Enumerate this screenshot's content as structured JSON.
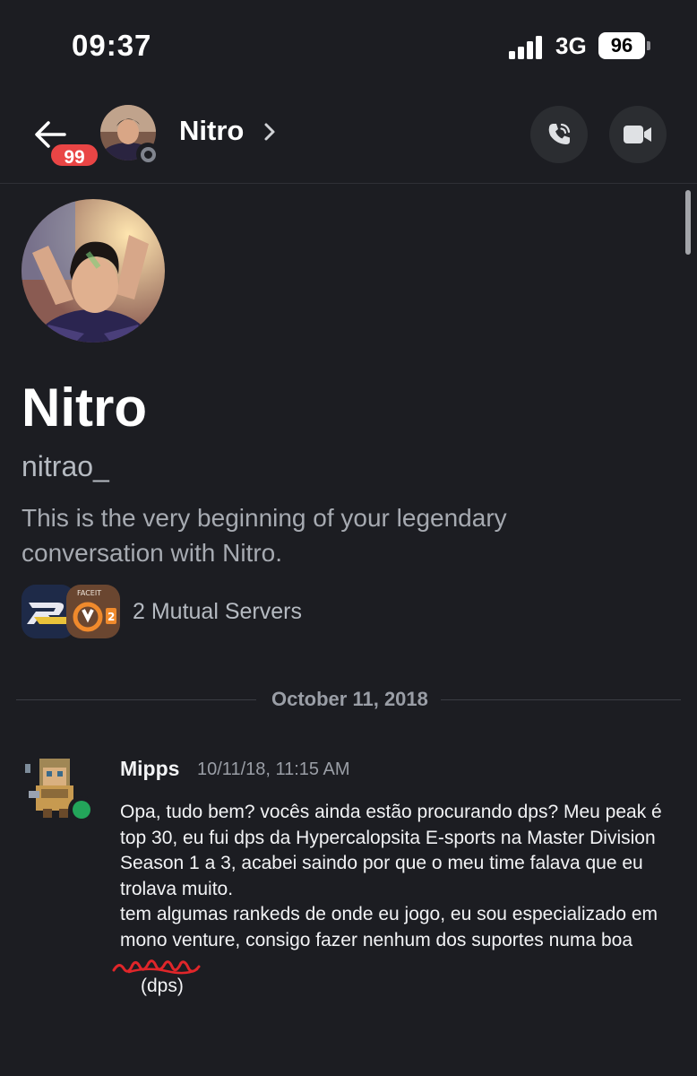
{
  "status_bar": {
    "time": "09:37",
    "network": "3G",
    "battery": "96"
  },
  "header": {
    "unread_count": "99",
    "name": "Nitro",
    "status": "offline",
    "actions": [
      "phone-call-icon",
      "video-camera-icon"
    ]
  },
  "profile": {
    "display_name": "Nitro",
    "username": "nitrao_",
    "intro": "This is the very beginning of your legendary conversation with Nitro.",
    "mutual_servers_label": "2 Mutual Servers"
  },
  "divider": {
    "date": "October 11, 2018"
  },
  "message": {
    "author": "Mipps",
    "timestamp": "10/11/18, 11:15 AM",
    "author_status": "online",
    "paragraph_1": "Opa, tudo bem? vocês ainda estão procurando dps? Meu peak é top 30, eu fui dps da Hypercalopsita E-sports na Master Division Season 1 a 3, acabei saindo por que o meu time falava que eu trolava muito.",
    "paragraph_2": "tem algumas rankeds de onde eu jogo, eu sou especializado em mono venture, consigo fazer nenhum dos suportes numa boa",
    "annotation": "(dps)"
  },
  "colors": {
    "background": "#1c1d22",
    "badge": "#e94545",
    "online": "#23a55a",
    "offline": "#80848e",
    "annotation_ink": "#e0262a"
  }
}
